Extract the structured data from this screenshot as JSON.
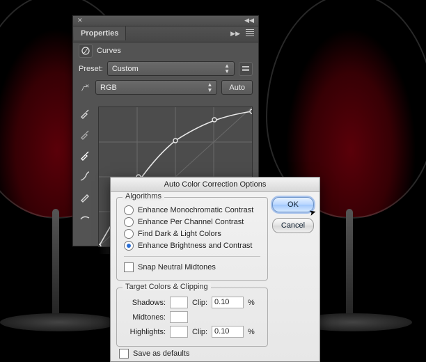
{
  "panel": {
    "title": "Properties",
    "adjustment_label": "Curves",
    "preset_label": "Preset:",
    "preset_value": "Custom",
    "channel_value": "RGB",
    "auto_label": "Auto"
  },
  "dialog": {
    "title": "Auto Color Correction Options",
    "algorithms_legend": "Algorithms",
    "options": [
      "Enhance Monochromatic Contrast",
      "Enhance Per Channel Contrast",
      "Find Dark & Light Colors",
      "Enhance Brightness and Contrast"
    ],
    "selected_option_index": 3,
    "snap_label": "Snap Neutral Midtones",
    "targets_legend": "Target Colors & Clipping",
    "rows": {
      "shadows_label": "Shadows:",
      "midtones_label": "Midtones:",
      "highlights_label": "Highlights:",
      "clip_label": "Clip:",
      "shadows_clip": "0.10",
      "highlights_clip": "0.10",
      "percent": "%"
    },
    "save_defaults_label": "Save as defaults",
    "ok_label": "OK",
    "cancel_label": "Cancel"
  }
}
